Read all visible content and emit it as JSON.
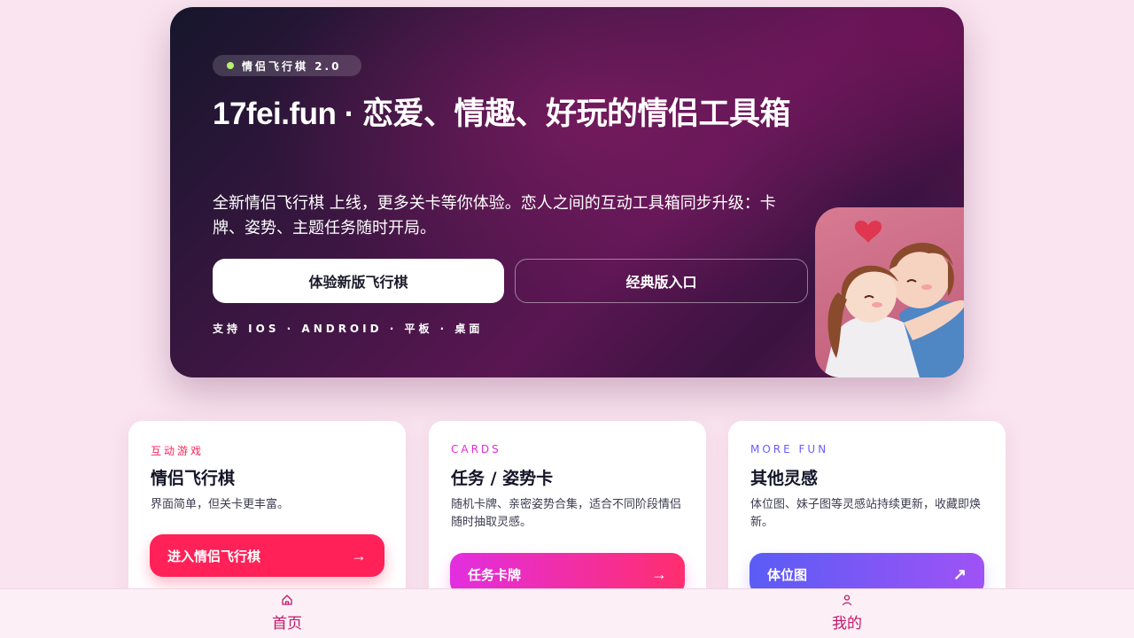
{
  "hero": {
    "badge": "情侣飞行棋 2.0",
    "title": "17fei.fun · 恋爱、情趣、好玩的情侣工具箱",
    "description": "全新情侣飞行棋 上线，更多关卡等你体验。恋人之间的互动工具箱同步升级：卡牌、姿势、主题任务随时开局。",
    "primary_button": "体验新版飞行棋",
    "secondary_button": "经典版入口",
    "support_text": "支持 IOS · ANDROID · 平板 · 桌面",
    "illustration_icon": "couple-hug-illustration"
  },
  "cards": [
    {
      "eyebrow": "互动游戏",
      "title": "情侣飞行棋",
      "description": "界面简单，但关卡更丰富。",
      "button": "进入情侣飞行棋",
      "button_icon": "arrow-right-icon",
      "accent": "#ff2157"
    },
    {
      "eyebrow": "CARDS",
      "title": "任务 / 姿势卡",
      "description": "随机卡牌、亲密姿势合集，适合不同阶段情侣随时抽取灵感。",
      "button": "任务卡牌",
      "button_icon": "arrow-right-icon",
      "accent": "#e52bd6"
    },
    {
      "eyebrow": "MORE FUN",
      "title": "其他灵感",
      "description": "体位图、妹子图等灵感站持续更新，收藏即焕新。",
      "button": "体位图",
      "button_icon": "arrow-up-right-icon",
      "accent": "#6b5cff"
    }
  ],
  "nav": {
    "home": "首页",
    "home_icon": "home-icon",
    "profile": "我的",
    "profile_icon": "user-icon"
  }
}
